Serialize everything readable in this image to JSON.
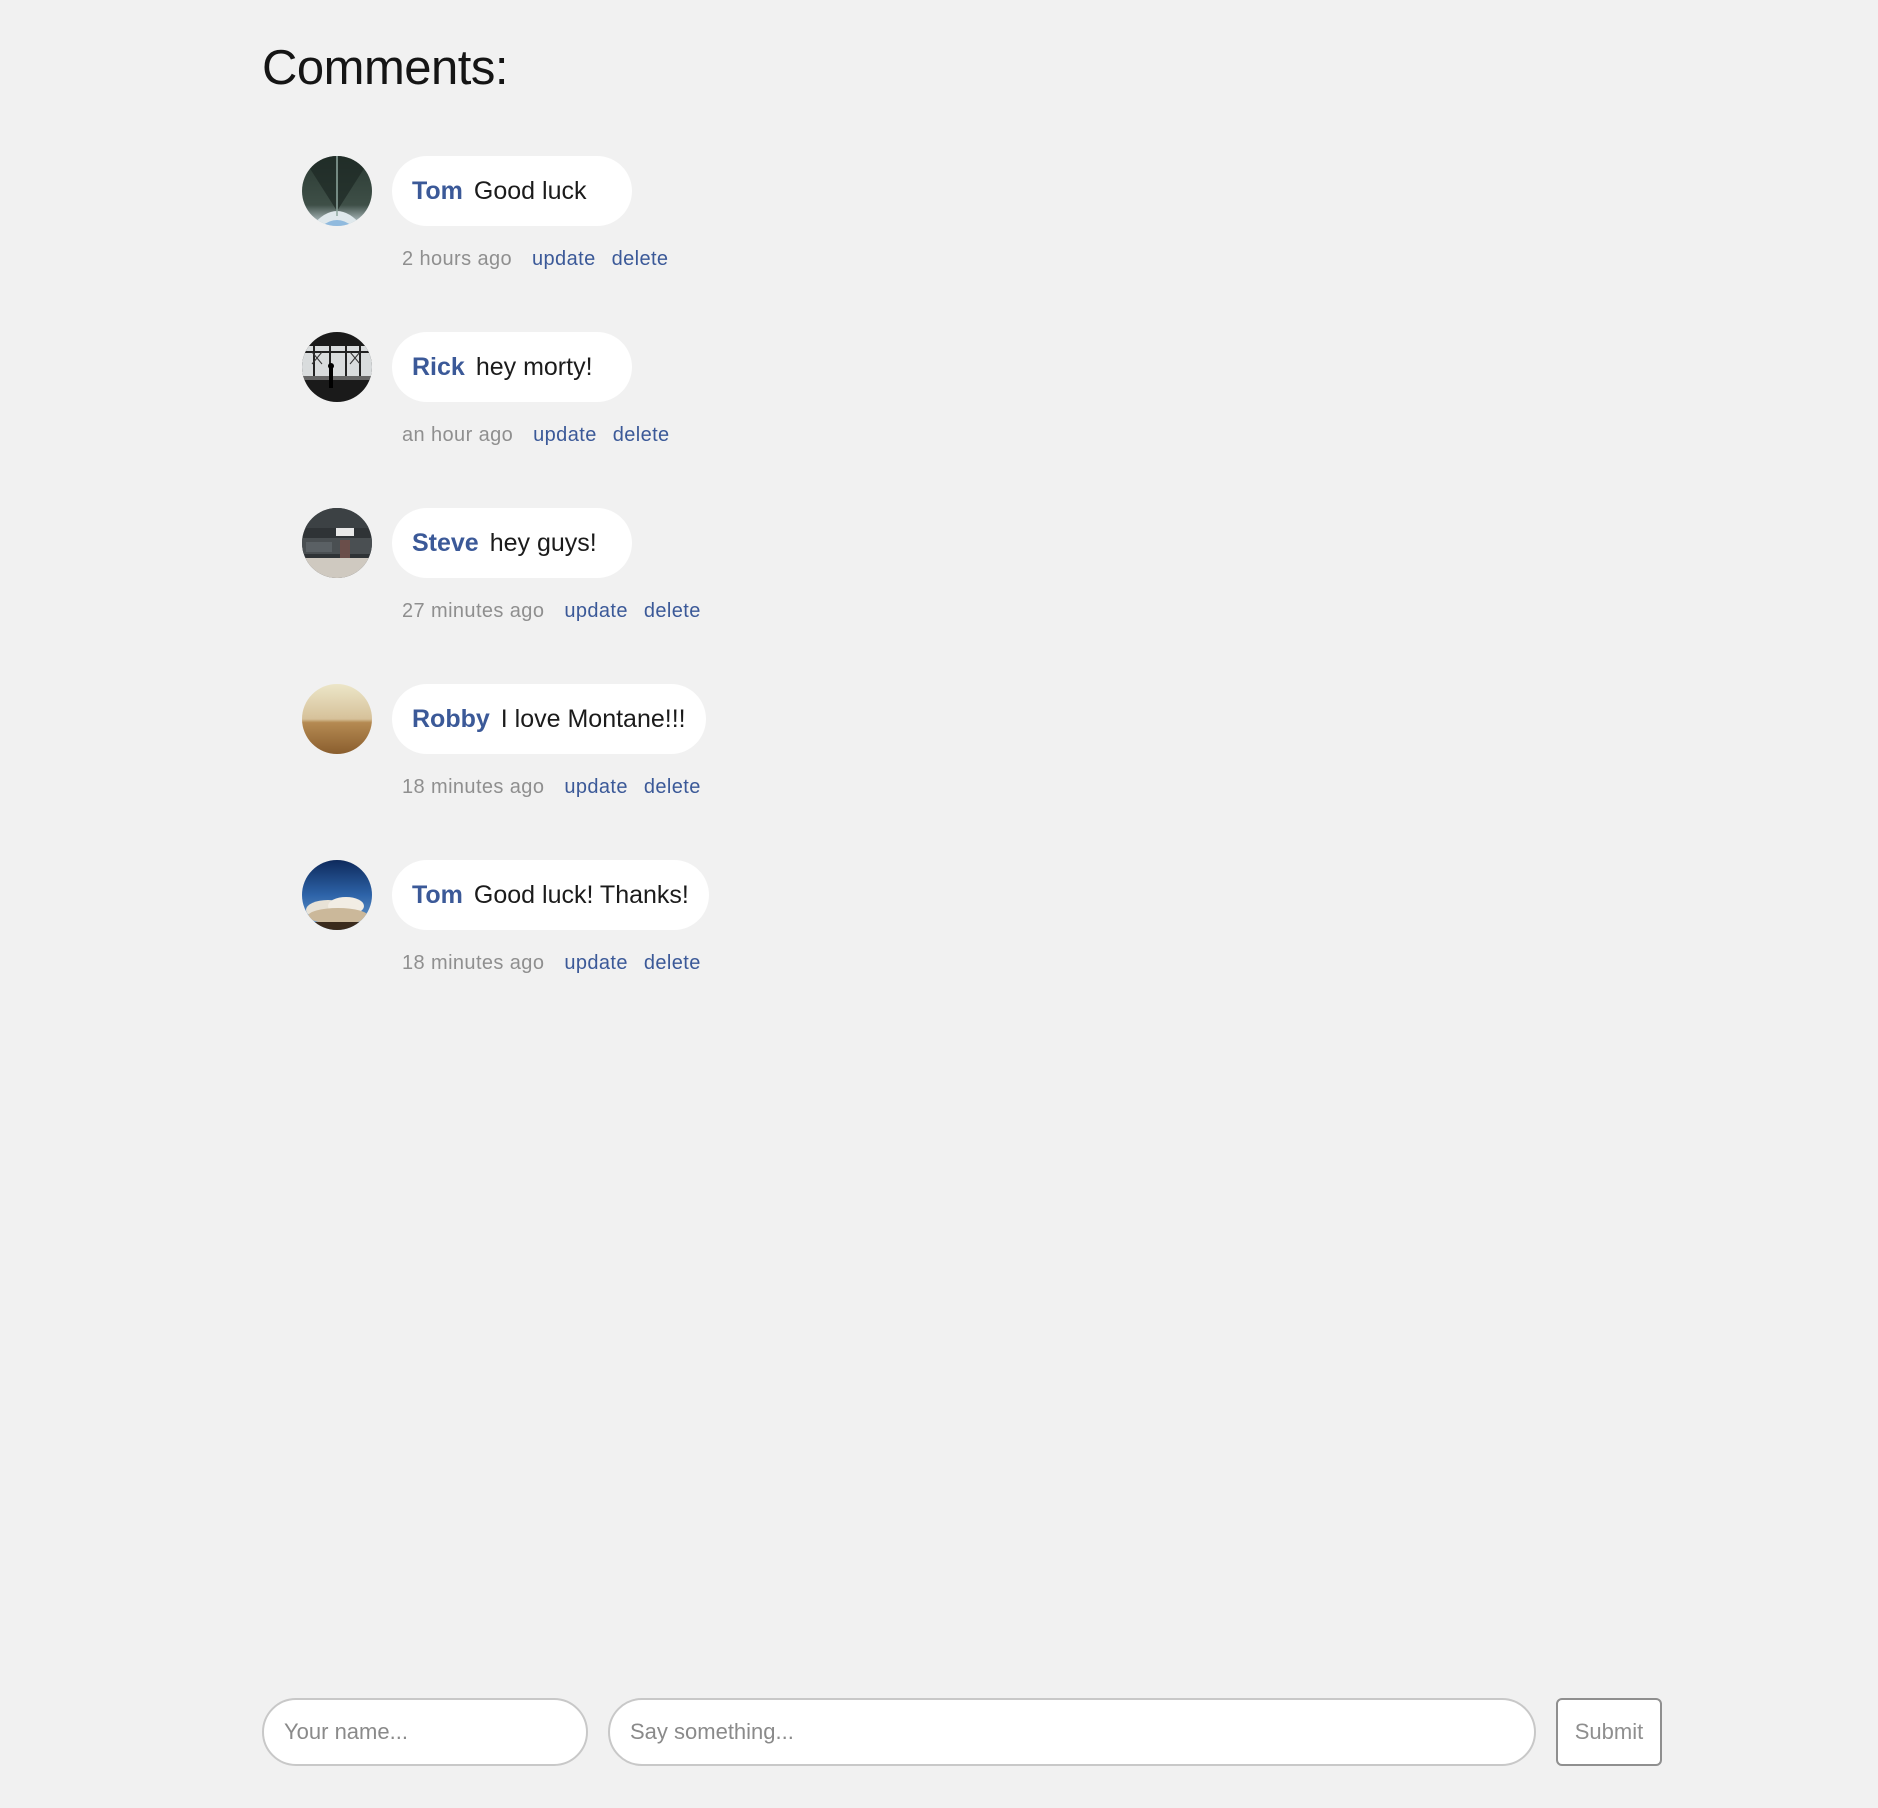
{
  "page": {
    "title": "Comments:"
  },
  "colors": {
    "background": "#f1f1f1",
    "accent": "#3b5998",
    "muted": "#8f8f8f",
    "bubble": "#ffffff"
  },
  "comments": [
    {
      "author": "Tom",
      "text": "Good luck",
      "time": "2 hours ago",
      "update_label": "update",
      "delete_label": "delete",
      "avatar": "tunnel-photo"
    },
    {
      "author": "Rick",
      "text": "hey morty!",
      "time": "an hour ago",
      "update_label": "update",
      "delete_label": "delete",
      "avatar": "station-silhouette-photo"
    },
    {
      "author": "Steve",
      "text": "hey guys!",
      "time": "27 minutes ago",
      "update_label": "update",
      "delete_label": "delete",
      "avatar": "dark-interior-photo"
    },
    {
      "author": "Robby",
      "text": "I love Montane!!!",
      "time": "18 minutes ago",
      "update_label": "update",
      "delete_label": "delete",
      "avatar": "desert-horizon-photo"
    },
    {
      "author": "Tom",
      "text": "Good luck! Thanks!",
      "time": "18 minutes ago",
      "update_label": "update",
      "delete_label": "delete",
      "avatar": "sky-clouds-photo"
    }
  ],
  "form": {
    "name_placeholder": "Your name...",
    "message_placeholder": "Say something...",
    "submit_label": "Submit"
  }
}
